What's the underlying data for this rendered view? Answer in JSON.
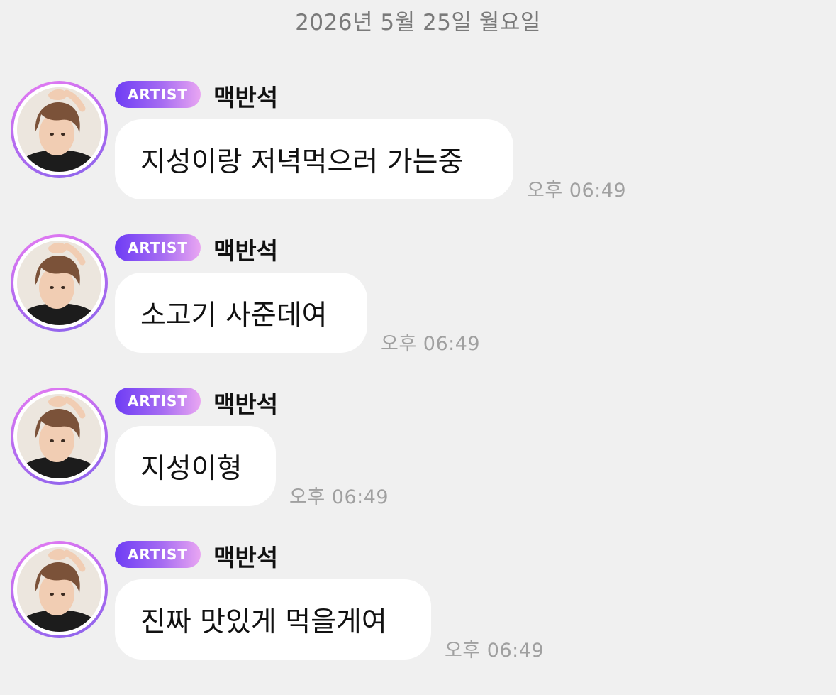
{
  "date_header": "2026년 5월 25일 월요일",
  "messages": [
    {
      "badge": "ARTIST",
      "sender": "맥반석",
      "text": "지성이랑 저녁먹으러 가는중",
      "time": "오후 06:49"
    },
    {
      "badge": "ARTIST",
      "sender": "맥반석",
      "text": "소고기 사준데여",
      "time": "오후 06:49"
    },
    {
      "badge": "ARTIST",
      "sender": "맥반석",
      "text": "지성이형",
      "time": "오후 06:49"
    },
    {
      "badge": "ARTIST",
      "sender": "맥반석",
      "text": "진짜 맛있게 먹을게여",
      "time": "오후 06:49"
    }
  ],
  "colors": {
    "background": "#f0f0f0",
    "bubble": "#ffffff",
    "badge_gradient_start": "#6e3cf5",
    "badge_gradient_end": "#e9a6f2",
    "avatar_ring": "#b86cf0",
    "time_text": "#a0a0a0",
    "date_text": "#7a7a7a"
  }
}
